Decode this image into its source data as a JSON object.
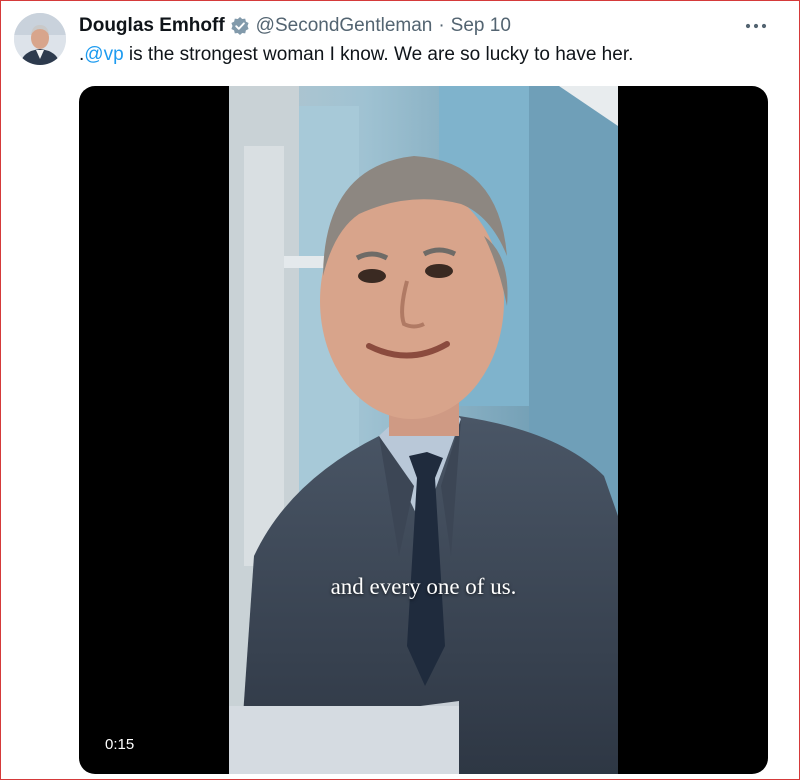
{
  "tweet": {
    "author_name": "Douglas Emhoff",
    "handle": "@SecondGentleman",
    "separator": "·",
    "date": "Sep 10",
    "text_prefix": ".",
    "mention": "@vp",
    "text_rest": " is the strongest woman I know. We are so lucky to have her.",
    "more_label": "···"
  },
  "media": {
    "caption": "and every one of us.",
    "duration": "0:15"
  },
  "icons": {
    "verified": "verified-badge-icon",
    "more": "more-options-icon"
  },
  "colors": {
    "link": "#1d9bf0",
    "muted_text": "#536471",
    "verified": "#829aab",
    "border": "#d53a3a"
  }
}
